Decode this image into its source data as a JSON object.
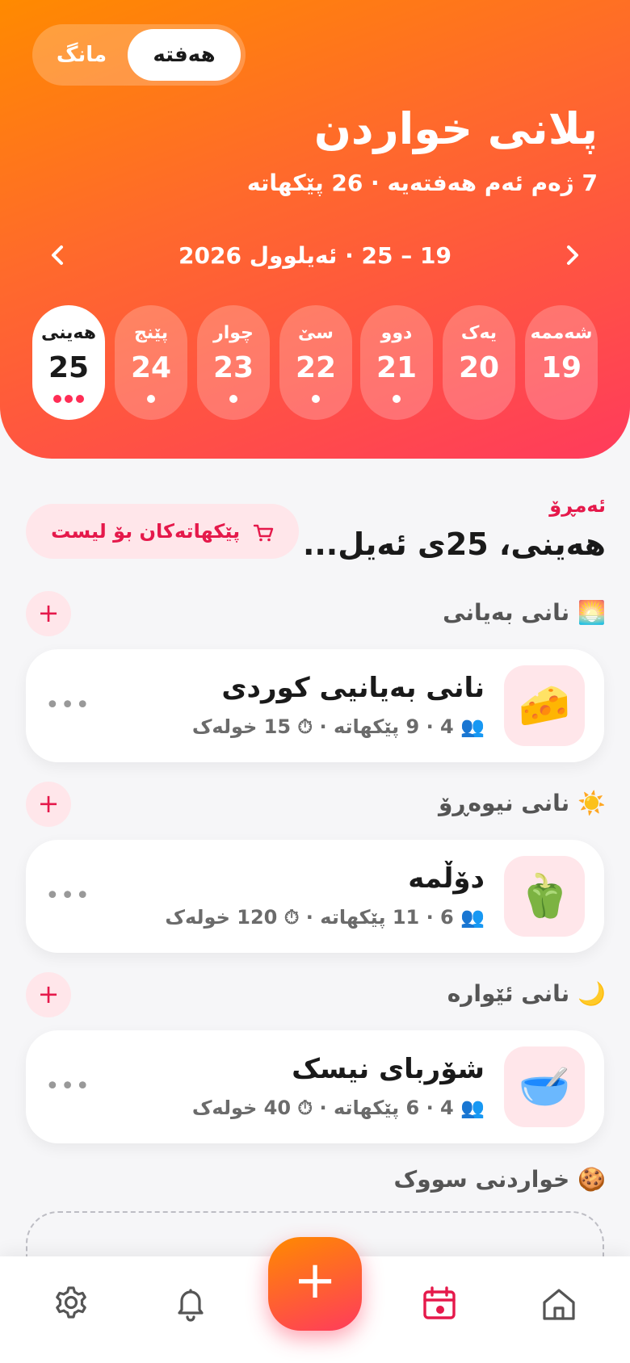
{
  "header": {
    "toggle": {
      "week": "هەفتە",
      "month": "مانگ"
    },
    "title": "پلانی خواردن",
    "subtitle": "7 ژەم ئەم هەفتەیە · 26 پێکهاتە",
    "range": "19 – 25 · ئەیلوول 2026",
    "days": [
      {
        "name": "شەممە",
        "num": "19",
        "dots": 0
      },
      {
        "name": "یەک",
        "num": "20",
        "dots": 0
      },
      {
        "name": "دوو",
        "num": "21",
        "dots": 1
      },
      {
        "name": "سێ",
        "num": "22",
        "dots": 1
      },
      {
        "name": "چوار",
        "num": "23",
        "dots": 1
      },
      {
        "name": "پێنج",
        "num": "24",
        "dots": 1
      },
      {
        "name": "هەینی",
        "num": "25",
        "dots": 3
      }
    ]
  },
  "today": {
    "label": "ئەمڕۆ",
    "date": "هەینی، 25ی ئەیل...",
    "shop_button": "پێکهاتەکان بۆ لیست"
  },
  "sections": {
    "breakfast": {
      "emoji": "🌅",
      "title": "نانی بەیانی",
      "meal": {
        "icon": "🧀",
        "name": "نانی بەیانیی کوردی",
        "meta": "👥 4 · 9 پێکهاتە · ⏱ 15 خولەک"
      }
    },
    "lunch": {
      "emoji": "☀️",
      "title": "نانی نیوەڕۆ",
      "meal": {
        "icon": "🫑",
        "name": "دۆڵمە",
        "meta": "👥 6 · 11 پێکهاتە · ⏱ 120 خولەک"
      }
    },
    "dinner": {
      "emoji": "🌙",
      "title": "نانی ئێوارە",
      "meal": {
        "icon": "🥣",
        "name": "شۆربای نیسک",
        "meta": "👥 4 · 6 پێکهاتە · ⏱ 40 خولەک"
      }
    },
    "snack": {
      "emoji": "🍪",
      "title": "خواردنی سووک"
    }
  },
  "ui": {
    "more": "•••",
    "add": "+",
    "fab": "+"
  }
}
